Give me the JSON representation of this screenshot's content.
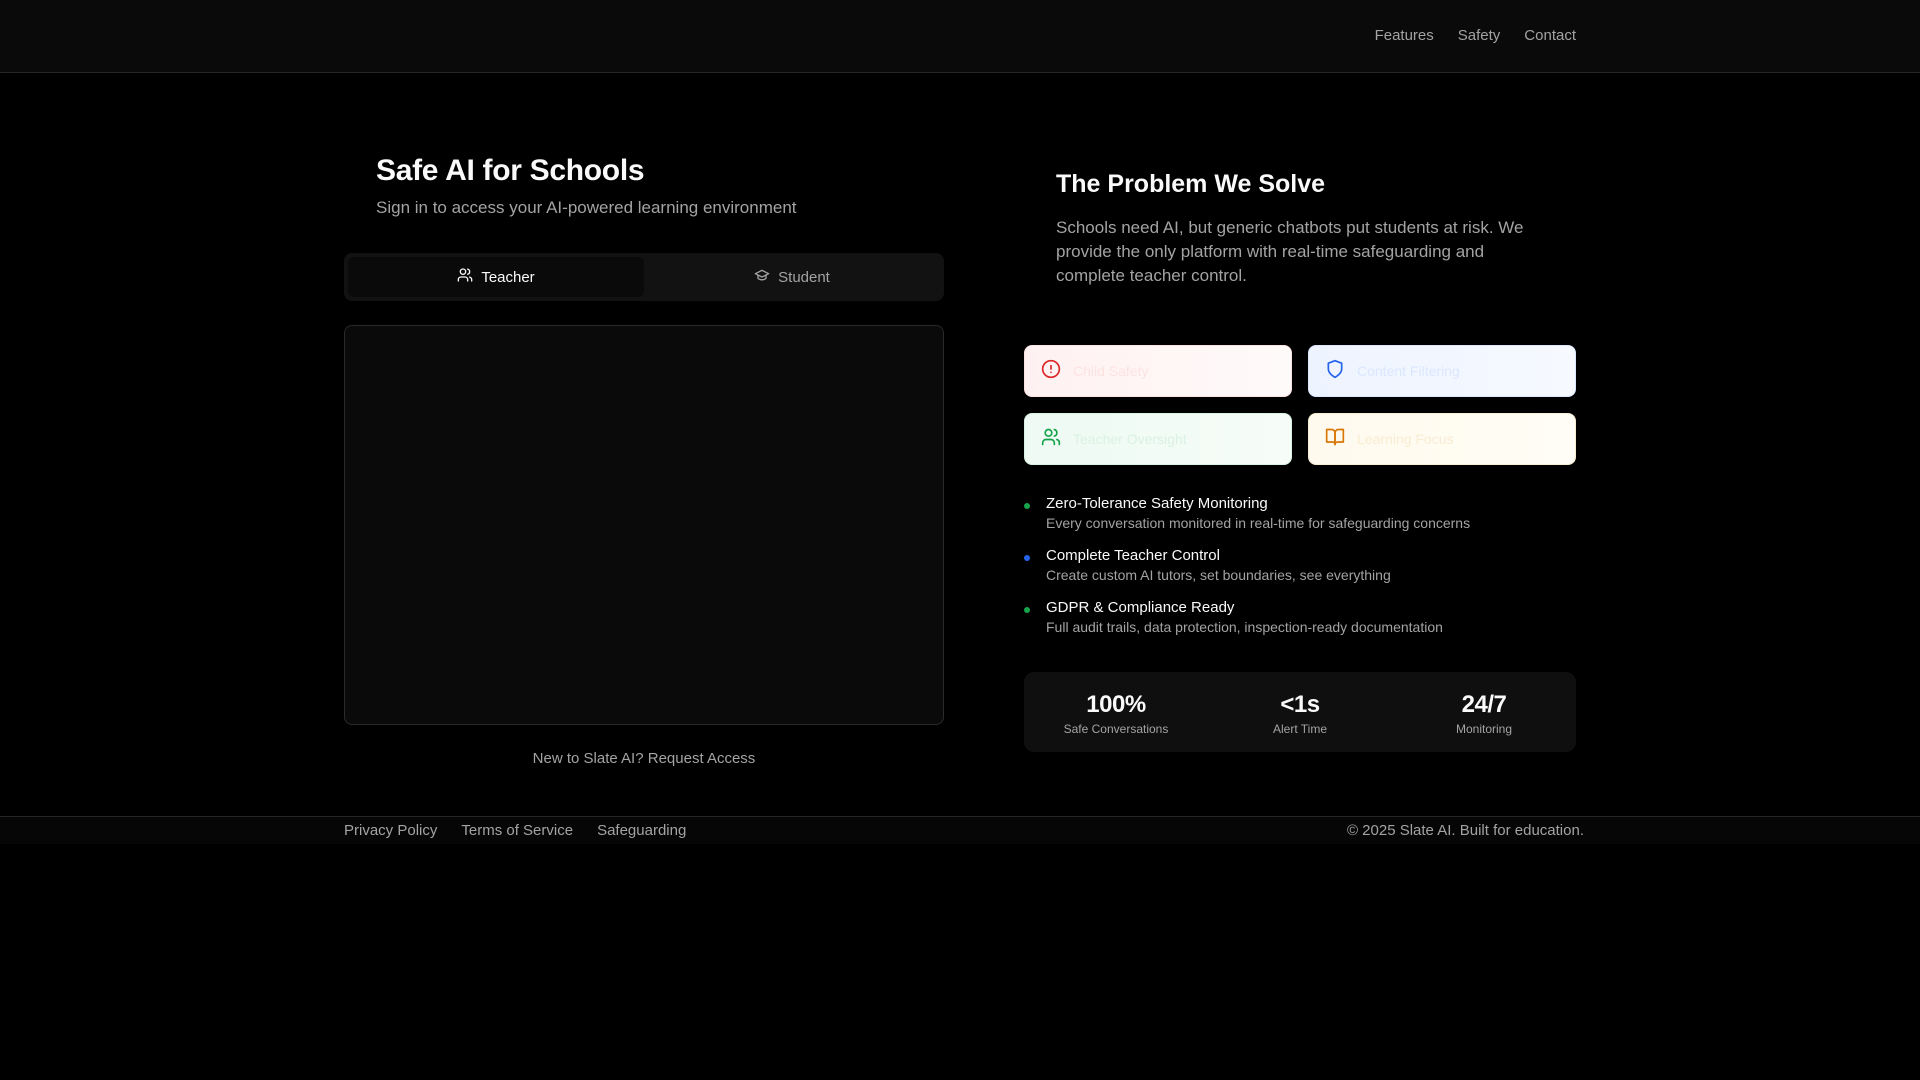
{
  "header": {
    "nav": [
      "Features",
      "Safety",
      "Contact"
    ]
  },
  "login": {
    "title": "Safe AI for Schools",
    "subtitle": "Sign in to access your AI-powered learning environment",
    "tabs": [
      {
        "label": "Teacher",
        "icon": "users-icon",
        "active": true
      },
      {
        "label": "Student",
        "icon": "graduation-cap-icon",
        "active": false
      }
    ],
    "request_prefix": "New to Slate AI?",
    "request_link": "Request Access"
  },
  "problem": {
    "title": "The Problem We Solve",
    "text": "Schools need AI, but generic chatbots put students at risk. We provide the only platform with real-time safeguarding and complete teacher control.",
    "cards": [
      {
        "label": "Child Safety",
        "icon": "alert-circle-icon",
        "color": "#dc2626"
      },
      {
        "label": "Content Filtering",
        "icon": "shield-icon",
        "color": "#2563eb"
      },
      {
        "label": "Teacher Oversight",
        "icon": "users-icon",
        "color": "#16a34a"
      },
      {
        "label": "Learning Focus",
        "icon": "book-open-icon",
        "color": "#d97706"
      }
    ],
    "features": [
      {
        "title": "Zero-Tolerance Safety Monitoring",
        "desc": "Every conversation monitored in real-time for safeguarding concerns",
        "color": "#16a34a"
      },
      {
        "title": "Complete Teacher Control",
        "desc": "Create custom AI tutors, set boundaries, see everything",
        "color": "#2563eb"
      },
      {
        "title": "GDPR & Compliance Ready",
        "desc": "Full audit trails, data protection, inspection-ready documentation",
        "color": "#16a34a"
      }
    ],
    "stats": [
      {
        "value": "100%",
        "label": "Safe Conversations"
      },
      {
        "value": "<1s",
        "label": "Alert Time"
      },
      {
        "value": "24/7",
        "label": "Monitoring"
      }
    ]
  },
  "footer": {
    "links": [
      "Privacy Policy",
      "Terms of Service",
      "Safeguarding"
    ],
    "copyright": "© 2025 Slate AI. Built for education."
  }
}
